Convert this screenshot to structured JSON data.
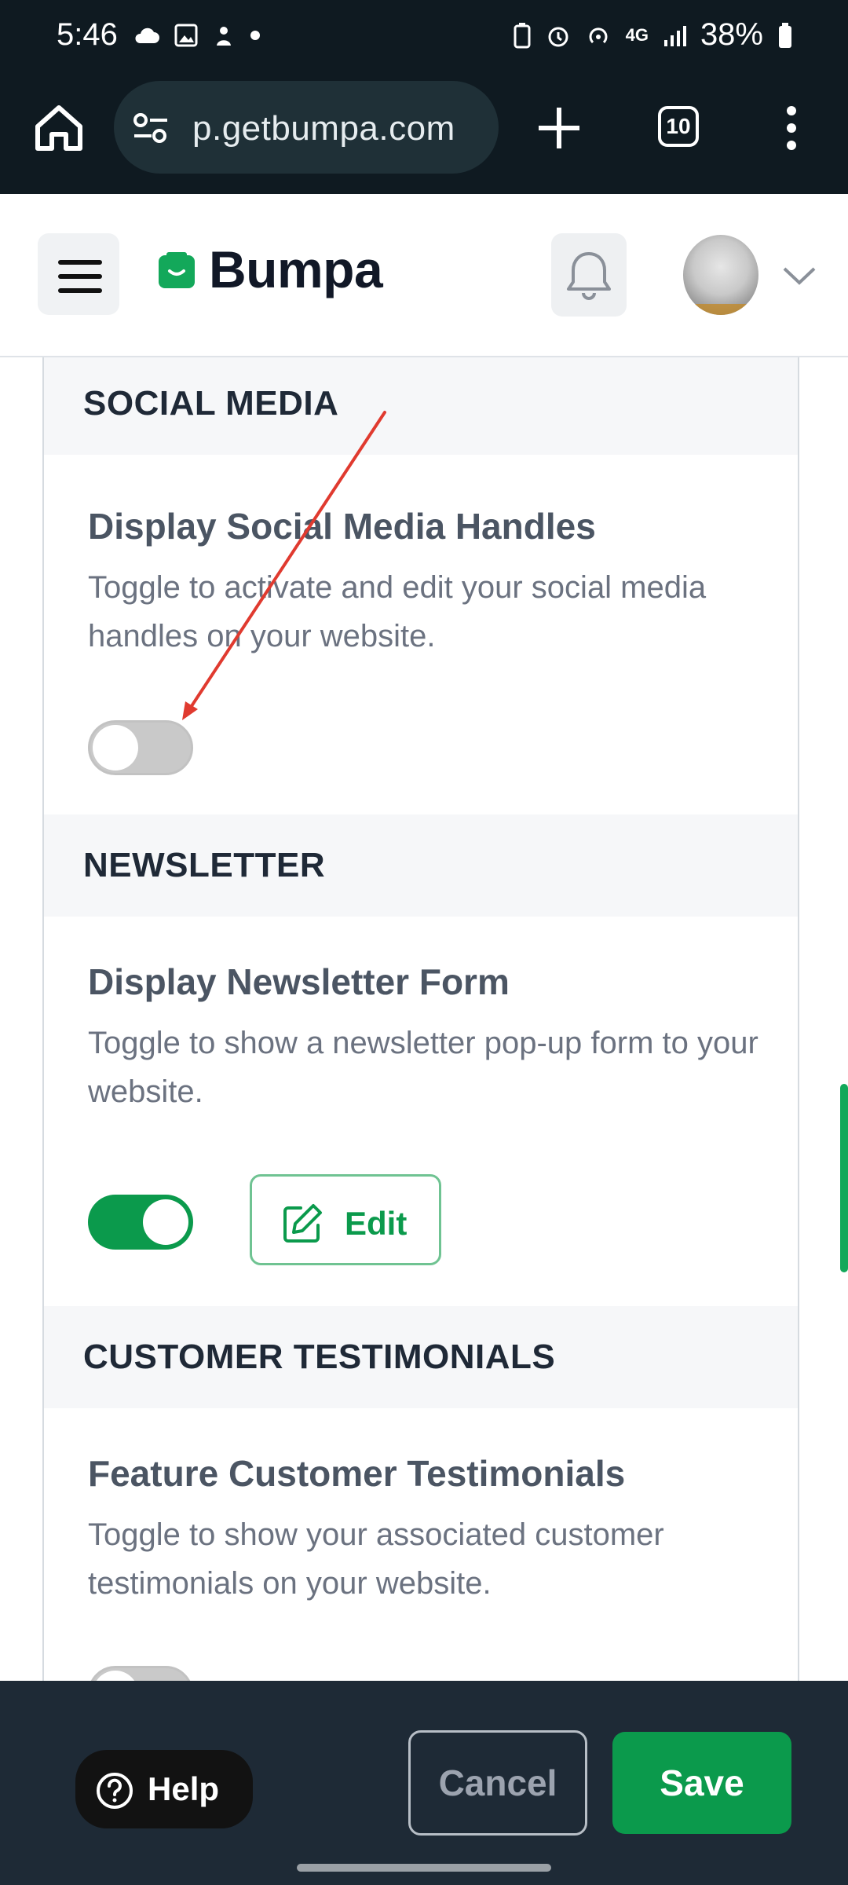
{
  "status_bar": {
    "time": "5:46",
    "network": "4G",
    "battery": "38%"
  },
  "browser": {
    "url": "p.getbumpa.com",
    "tab_count": "10"
  },
  "header": {
    "brand": "Bumpa"
  },
  "sections": {
    "social": {
      "heading": "SOCIAL MEDIA",
      "title": "Display Social Media Handles",
      "description": "Toggle to activate and edit your social media handles on your website.",
      "toggle_on": false
    },
    "newsletter": {
      "heading": "NEWSLETTER",
      "title": "Display Newsletter Form",
      "description": "Toggle to show a newsletter pop-up form to your website.",
      "toggle_on": true,
      "edit_label": "Edit"
    },
    "testimonials": {
      "heading": "CUSTOMER TESTIMONIALS",
      "title": "Feature Customer Testimonials",
      "description": "Toggle to show your associated customer testimonials on your website.",
      "toggle_on": false
    }
  },
  "actions": {
    "help": "Help",
    "cancel": "Cancel",
    "save": "Save"
  },
  "colors": {
    "brand_green": "#0b9a4c",
    "dark_bar": "#1e2a36",
    "annotation_red": "#e03a2f"
  },
  "icons": [
    "home-icon",
    "tune-icon",
    "plus-icon",
    "tabs-icon",
    "more-vert-icon",
    "menu-icon",
    "bell-icon",
    "chevron-down-icon",
    "edit-icon",
    "help-circle-icon"
  ]
}
